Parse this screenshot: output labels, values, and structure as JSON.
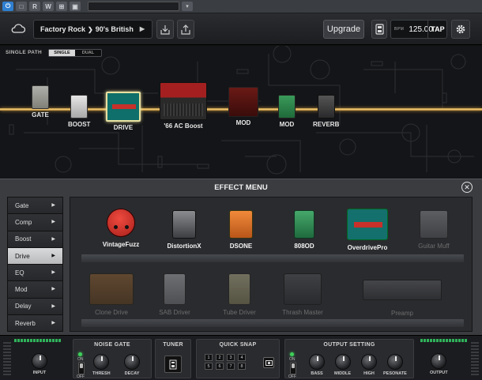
{
  "host": {
    "buttons": [
      "⏻",
      "□",
      "R",
      "W",
      "⊞",
      "▣"
    ],
    "power_on": true
  },
  "toolbar": {
    "preset_name": "Factory Rock",
    "preset_sub": "90's British",
    "preset_play": "▶",
    "upgrade_label": "Upgrade",
    "bpm_label": "BPM",
    "bpm_value": "125.00",
    "tap_label": "TAP"
  },
  "signal_path": {
    "label": "SINGLE PATH",
    "modes": [
      "SINGLE",
      "DUAL"
    ],
    "selected_mode": "SINGLE",
    "slots": [
      {
        "label": "GATE",
        "color": "#9a9a95"
      },
      {
        "label": "BOOST",
        "color": "#c8c8c8"
      },
      {
        "label": "DRIVE",
        "color": "#0f6f6a"
      },
      {
        "label": "'66 AC Boost",
        "color": "#8a1a1a"
      },
      {
        "label": "MOD",
        "color": "#5a1412"
      },
      {
        "label": "MOD",
        "color": "#2a7a46"
      },
      {
        "label": "REVERB",
        "color": "#3a3a3c"
      }
    ]
  },
  "effect_menu": {
    "title": "EFFECT MENU",
    "close_icon": "close-icon",
    "categories": [
      "Gate",
      "Comp",
      "Boost",
      "Drive",
      "EQ",
      "Mod",
      "Delay",
      "Reverb"
    ],
    "selected_category": "Drive",
    "effects_row1": [
      {
        "name": "VintageFuzz",
        "color": "#d8302a",
        "available": true
      },
      {
        "name": "DistortionX",
        "color": "#5b5d60",
        "available": true
      },
      {
        "name": "DSONE",
        "color": "#e0742a",
        "available": true
      },
      {
        "name": "808OD",
        "color": "#2f8a55",
        "available": true
      },
      {
        "name": "OverdrivePro",
        "color": "#14706c",
        "available": true
      },
      {
        "name": "Guitar Muff",
        "color": "#7a7c80",
        "available": false
      }
    ],
    "effects_row2": [
      {
        "name": "Clone Drive",
        "color": "#8a5a2a",
        "available": false
      },
      {
        "name": "SAB Driver",
        "color": "#9a9ca0",
        "available": false
      },
      {
        "name": "Tube Driver",
        "color": "#a8a27a",
        "available": false
      },
      {
        "name": "Thrash Master",
        "color": "#4a4b4f",
        "available": false
      },
      {
        "name": "Preamp",
        "color": "#5a5b5f",
        "available": false
      }
    ]
  },
  "bottom": {
    "input_label": "INPUT",
    "noise_gate": {
      "title": "NOISE GATE",
      "on": "ON",
      "off": "OFF",
      "knobs": [
        "THRESH",
        "DECAY"
      ]
    },
    "tuner": {
      "title": "TUNER"
    },
    "quick_snap": {
      "title": "QUICK SNAP",
      "slots": [
        "1",
        "2",
        "3",
        "4",
        "5",
        "6",
        "7",
        "8"
      ]
    },
    "output_setting": {
      "title": "OUTPUT SETTING",
      "on": "ON",
      "off": "OFF",
      "knobs": [
        "BASS",
        "MIDDLE",
        "HIGH",
        "PESONATE"
      ]
    },
    "output_label": "OUTPUT"
  },
  "colors": {
    "cable": "#f0c978",
    "accent": "#2f7fd0",
    "led": "#3fd05a"
  }
}
